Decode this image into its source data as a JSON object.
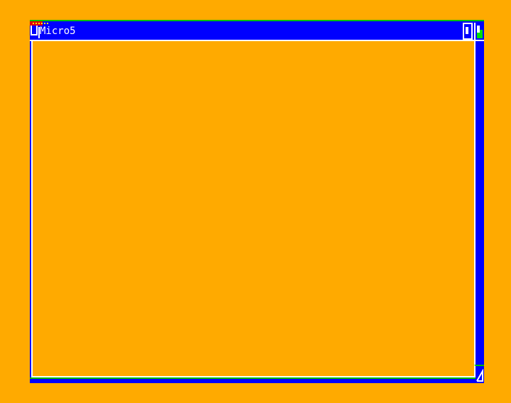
{
  "window": {
    "title": "Micro5"
  },
  "icons": {
    "close": "close-icon",
    "depth": "depth-arrange-icon",
    "zoom": "zoom-icon",
    "resize": "resize-icon"
  },
  "colors": {
    "background": "#FFAA00",
    "window_frame": "#0000FF",
    "highlight": "#FFFFFF",
    "accent_green": "#00C000",
    "accent_red": "#E00000"
  }
}
